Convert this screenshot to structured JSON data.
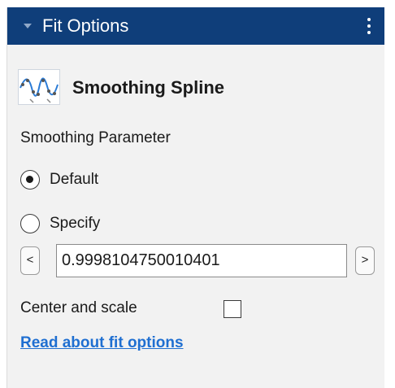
{
  "panel": {
    "title": "Fit Options",
    "menu_icon": "kebab-menu-icon",
    "collapse_icon": "triangle-down-icon"
  },
  "fit": {
    "icon": "smoothing-spline-icon",
    "name": "Smoothing Spline"
  },
  "smoothing": {
    "label": "Smoothing Parameter",
    "options": [
      {
        "label": "Default",
        "selected": true
      },
      {
        "label": "Specify",
        "selected": false
      }
    ],
    "value": "0.9998104750010401",
    "decrement_label": "<",
    "increment_label": ">"
  },
  "center_scale": {
    "label": "Center and scale",
    "checked": false
  },
  "link": {
    "label": "Read about fit options"
  },
  "colors": {
    "header_bg": "#0f3e7a",
    "panel_bg": "#f2f2f2",
    "link": "#1f6fd1"
  }
}
